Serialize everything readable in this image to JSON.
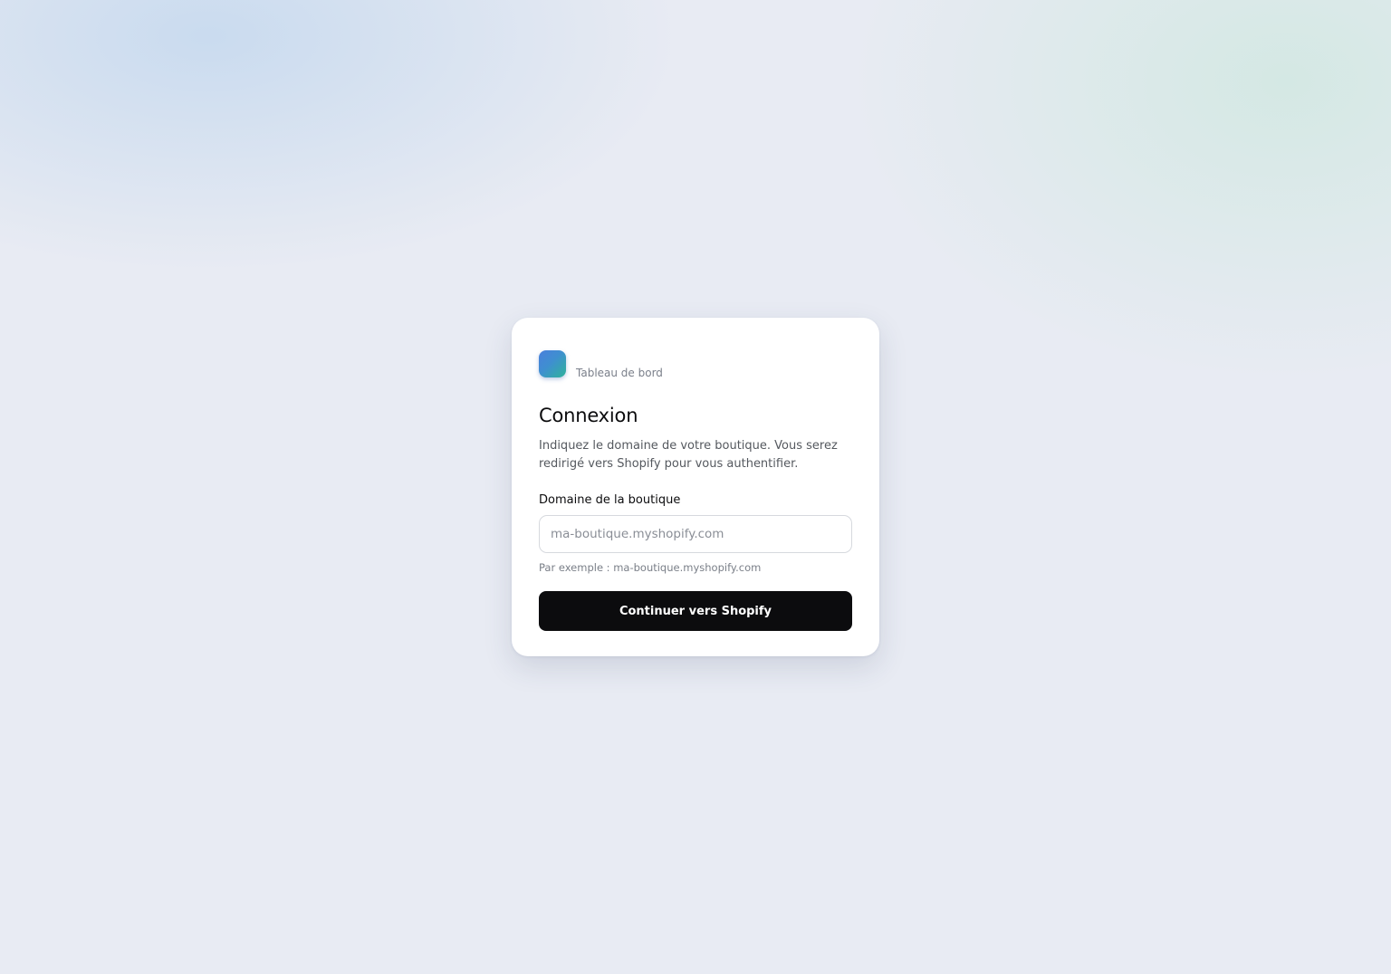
{
  "brand": {
    "name": "Tableau de bord",
    "logo_icon": "gradient-square-logo-icon",
    "logo_colors": [
      "#4a7fdc",
      "#2fb39a"
    ]
  },
  "login": {
    "title": "Connexion",
    "description": "Indiquez le domaine de votre boutique. Vous serez redirigé vers Shopify pour vous authentifier.",
    "field_label": "Domaine de la boutique",
    "input_value": "",
    "input_placeholder": "ma-boutique.myshopify.com",
    "hint": "Par exemple : ma-boutique.myshopify.com",
    "submit_label": "Continuer vers Shopify"
  },
  "colors": {
    "background": "#e8ebf3",
    "card": "#ffffff",
    "button": "#0c0c0e",
    "button_text": "#ffffff"
  }
}
